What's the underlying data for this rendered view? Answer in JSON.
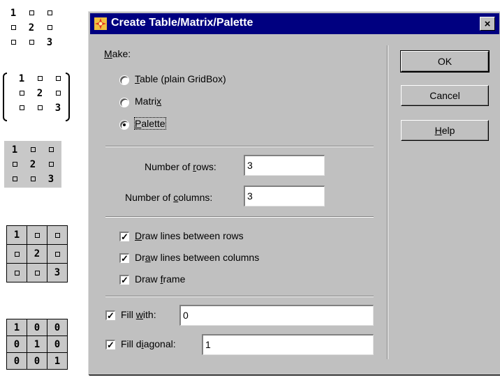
{
  "previews": {
    "plain": [
      "1",
      "2",
      "3"
    ],
    "matrix": [
      "1",
      "2",
      "3"
    ],
    "palette": [
      "1",
      "2",
      "3"
    ],
    "lined": [
      "1",
      "2",
      "3"
    ],
    "filled": [
      [
        "1",
        "0",
        "0"
      ],
      [
        "0",
        "1",
        "0"
      ],
      [
        "0",
        "0",
        "1"
      ]
    ]
  },
  "dialog": {
    "title": "Create Table/Matrix/Palette",
    "close_glyph": "×",
    "make_label": {
      "key": "M",
      "rest": "ake:"
    },
    "radios": [
      {
        "pre": "",
        "key": "T",
        "post": "able (plain GridBox)",
        "checked": false
      },
      {
        "pre": "Matri",
        "key": "x",
        "post": "",
        "checked": false
      },
      {
        "pre": "",
        "key": "P",
        "post": "alette",
        "checked": true
      }
    ],
    "rows_label": {
      "pre": "Number of ",
      "key": "r",
      "post": "ows:"
    },
    "rows_value": "3",
    "cols_label": {
      "pre": "Number of ",
      "key": "c",
      "post": "olumns:"
    },
    "cols_value": "3",
    "checks": [
      {
        "pre": "",
        "key": "D",
        "post": "raw lines between rows",
        "checked": true
      },
      {
        "pre": "Dr",
        "key": "a",
        "post": "w lines between columns",
        "checked": true
      },
      {
        "pre": "Draw ",
        "key": "f",
        "post": "rame",
        "checked": true
      }
    ],
    "fill_with": {
      "pre": "Fill ",
      "key": "w",
      "post": "ith:",
      "checked": true,
      "value": "0"
    },
    "fill_diag": {
      "pre": "Fill d",
      "key": "i",
      "post": "agonal:",
      "checked": true,
      "value": "1"
    },
    "buttons": {
      "ok": "OK",
      "cancel": "Cancel",
      "help_key": "H",
      "help_rest": "elp"
    },
    "check_glyph": "✓"
  }
}
